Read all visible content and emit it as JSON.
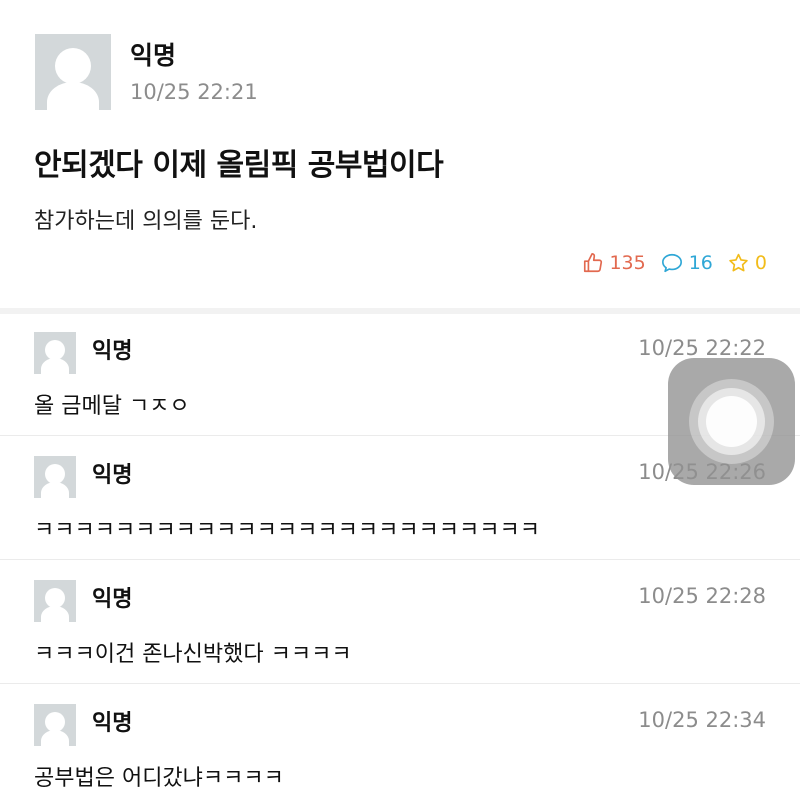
{
  "post": {
    "author": "익명",
    "time": "10/25 22:21",
    "title": "안되겠다 이제 올림픽 공부법이다",
    "body": "참가하는데 의의를 둔다.",
    "stats": {
      "likes": "135",
      "comments": "16",
      "scraps": "0"
    }
  },
  "comments": [
    {
      "author": "익명",
      "time": "10/25 22:22",
      "text": "올 금메달 ㄱㅈㅇ"
    },
    {
      "author": "익명",
      "time": "10/25 22:26",
      "text": "ㅋㅋㅋㅋㅋㅋㅋㅋㅋㅋㅋㅋㅋㅋㅋㅋㅋㅋㅋㅋㅋㅋㅋㅋㅋ"
    },
    {
      "author": "익명",
      "time": "10/25 22:28",
      "text": "ㅋㅋㅋ이건 존나신박했다 ㅋㅋㅋㅋ"
    },
    {
      "author": "익명",
      "time": "10/25 22:34",
      "text": "공부법은 어디갔냐ㅋㅋㅋㅋ"
    }
  ],
  "colors": {
    "like": "#e2694f",
    "comment": "#2fa7d6",
    "scrap": "#f2bc1a",
    "timestamp": "#8c8c8c",
    "avatar_bg": "#d3d8da"
  },
  "icons": {
    "like": "thumbs-up-icon",
    "comment": "speech-bubble-icon",
    "scrap": "star-icon",
    "overlay": "assistive-touch-icon"
  }
}
